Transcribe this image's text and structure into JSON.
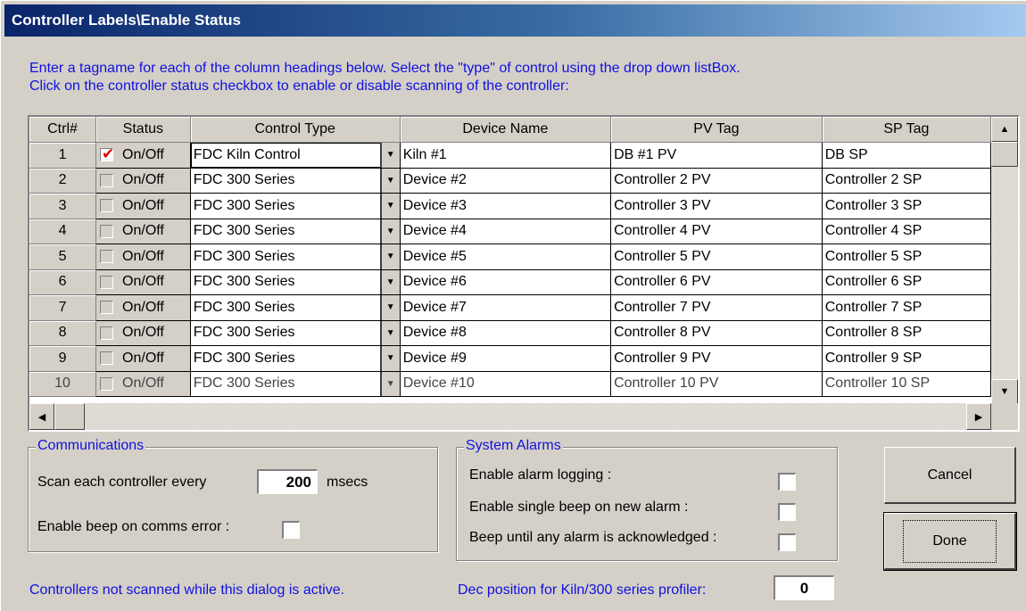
{
  "window": {
    "title": "Controller Labels\\Enable Status"
  },
  "instructions": {
    "line1": "Enter a tagname for each of the column headings below.  Select the \"type\" of control using the drop down listBox.",
    "line2": "Click on the controller status checkbox to enable or disable scanning of the controller:"
  },
  "grid": {
    "columns": [
      "Ctrl#",
      "Status",
      "Control Type",
      "Device Name",
      "PV Tag",
      "SP Tag"
    ],
    "rows": [
      {
        "num": "1",
        "status": "On/Off",
        "checked": true,
        "type": "FDC Kiln Control",
        "device": "Kiln #1",
        "pv": "DB #1 PV",
        "sp": "DB SP"
      },
      {
        "num": "2",
        "status": "On/Off",
        "checked": false,
        "type": "FDC 300 Series",
        "device": "Device #2",
        "pv": "Controller 2 PV",
        "sp": "Controller 2 SP"
      },
      {
        "num": "3",
        "status": "On/Off",
        "checked": false,
        "type": "FDC 300 Series",
        "device": "Device #3",
        "pv": "Controller 3 PV",
        "sp": "Controller 3 SP"
      },
      {
        "num": "4",
        "status": "On/Off",
        "checked": false,
        "type": "FDC 300 Series",
        "device": "Device #4",
        "pv": "Controller 4 PV",
        "sp": "Controller 4 SP"
      },
      {
        "num": "5",
        "status": "On/Off",
        "checked": false,
        "type": "FDC 300 Series",
        "device": "Device #5",
        "pv": "Controller 5 PV",
        "sp": "Controller 5 SP"
      },
      {
        "num": "6",
        "status": "On/Off",
        "checked": false,
        "type": "FDC 300 Series",
        "device": "Device #6",
        "pv": "Controller 6 PV",
        "sp": "Controller 6 SP"
      },
      {
        "num": "7",
        "status": "On/Off",
        "checked": false,
        "type": "FDC 300 Series",
        "device": "Device #7",
        "pv": "Controller 7 PV",
        "sp": "Controller 7 SP"
      },
      {
        "num": "8",
        "status": "On/Off",
        "checked": false,
        "type": "FDC 300 Series",
        "device": "Device #8",
        "pv": "Controller 8 PV",
        "sp": "Controller 8 SP"
      },
      {
        "num": "9",
        "status": "On/Off",
        "checked": false,
        "type": "FDC 300 Series",
        "device": "Device #9",
        "pv": "Controller 9 PV",
        "sp": "Controller 9 SP"
      },
      {
        "num": "10",
        "status": "On/Off",
        "checked": false,
        "type": "FDC 300 Series",
        "device": "Device #10",
        "pv": "Controller 10 PV",
        "sp": "Controller 10 SP"
      }
    ],
    "dropdown_icon": "chevron-down-icon"
  },
  "communications": {
    "title": "Communications",
    "scan_label": "Scan each controller every",
    "scan_value": "200",
    "scan_unit": "msecs",
    "beep_label": "Enable beep on comms error :",
    "beep_checked": false
  },
  "alarms": {
    "title": "System Alarms",
    "logging_label": "Enable alarm logging :",
    "single_beep_label": "Enable single beep on new alarm :",
    "beep_until_label": "Beep until any alarm is acknowledged :"
  },
  "buttons": {
    "cancel": "Cancel",
    "done": "Done"
  },
  "footer": {
    "note": "Controllers  not scanned while this dialog is active.",
    "dec_label": "Dec position for Kiln/300 series profiler:",
    "dec_value": "0"
  },
  "colors": {
    "accent_text": "#1010e0",
    "title_gradient_start": "#0a246a",
    "check_mark": "#e00000"
  }
}
